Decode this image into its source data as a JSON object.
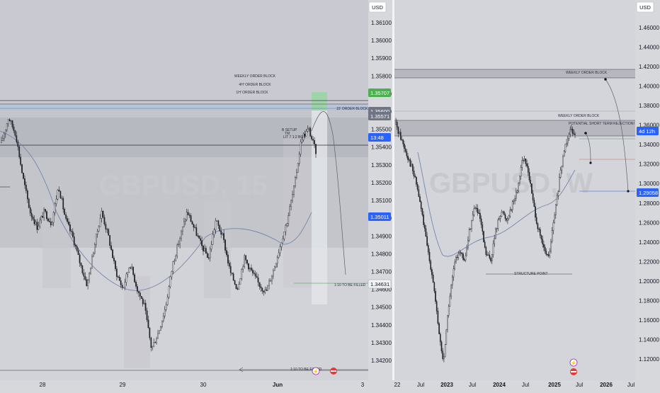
{
  "left": {
    "currency_label": "USD",
    "watermark_symbol": "GBPUSD, 15",
    "y_ticks": [
      "1.36100",
      "1.36000",
      "1.35900",
      "1.35800",
      "1.35700",
      "1.35600",
      "1.35500",
      "1.35400",
      "1.35300",
      "1.35200",
      "1.35100",
      "1.35000",
      "1.34900",
      "1.34800",
      "1.34700",
      "1.34600",
      "1.34500",
      "1.34400",
      "1.34300",
      "1.34200"
    ],
    "x_ticks": [
      "28",
      "29",
      "30",
      "Jun",
      "3"
    ],
    "price_tags": [
      {
        "label": "1.35707",
        "color": "#4caf50"
      },
      {
        "label": "1.35600",
        "color": "#707585"
      },
      {
        "label": "1.35571",
        "color": "#707585"
      },
      {
        "label": "13:48",
        "color": "#2962ff"
      },
      {
        "label": "1.35011",
        "color": "#2962ff"
      },
      {
        "label": "1.34631",
        "color": "#f0f2f5",
        "text_color": "#131722"
      }
    ],
    "annotations": {
      "weekly_ob": "WEEKLY ORDER BLOCK",
      "ob_4h": "4H' ORDER BLOCK",
      "ob_1h": "1H' ORDER BLOCK",
      "ob_15": "15' ORDER BLOCK",
      "setup_1": "B SETUP",
      "setup_2": "TM",
      "setup_3": "LIT 7 1:2 BOS",
      "target": "1:10 TO BE FILLED",
      "bottom_note": "1:10 TO BE FILLED"
    }
  },
  "right": {
    "currency_label": "USD",
    "watermark_symbol": "GBPUSD, W",
    "y_ticks": [
      "1.46000",
      "1.44000",
      "1.42000",
      "1.40000",
      "1.38000",
      "1.36000",
      "1.34000",
      "1.32000",
      "1.30000",
      "1.28000",
      "1.26000",
      "1.24000",
      "1.22000",
      "1.20000",
      "1.18000",
      "1.16000",
      "1.14000",
      "1.12000"
    ],
    "x_ticks": [
      "22",
      "Jul",
      "2023",
      "Jul",
      "2024",
      "Jul",
      "2025",
      "Jul",
      "2026",
      "Jul"
    ],
    "price_tags": [
      {
        "label": "4d 12h",
        "color": "#2962ff"
      },
      {
        "label": "1.29058",
        "color": "#2962ff"
      }
    ],
    "annotations": {
      "weekly_ob_top": "WEEKLY ORDER BLOCK",
      "weekly_ob": "WEEKLY ORDER BLOCK",
      "rejection": "POTENTIAL SHORT TERM REJECTION!",
      "structure": "STRUCTURE POINT"
    }
  },
  "chart_data": [
    {
      "type": "candlestick",
      "symbol": "GBPUSD",
      "timeframe": "15",
      "x_ticks": [
        "28",
        "29",
        "30",
        "Jun",
        "3"
      ],
      "ylim": [
        1.3415,
        1.362
      ],
      "close_path": [
        {
          "x": "27 early",
          "y": 1.3545
        },
        {
          "x": "27",
          "y": 1.356
        },
        {
          "x": "27",
          "y": 1.355
        },
        {
          "x": "27",
          "y": 1.3525
        },
        {
          "x": "27",
          "y": 1.3505
        },
        {
          "x": "27",
          "y": 1.3496
        },
        {
          "x": "27",
          "y": 1.3505
        },
        {
          "x": "27",
          "y": 1.3498
        },
        {
          "x": "27 late",
          "y": 1.352
        },
        {
          "x": "28",
          "y": 1.35
        },
        {
          "x": "28",
          "y": 1.349
        },
        {
          "x": "28",
          "y": 1.3475
        },
        {
          "x": "28",
          "y": 1.3462
        },
        {
          "x": "28",
          "y": 1.3485
        },
        {
          "x": "28",
          "y": 1.3505
        },
        {
          "x": "28",
          "y": 1.349
        },
        {
          "x": "28",
          "y": 1.347
        },
        {
          "x": "28",
          "y": 1.346
        },
        {
          "x": "28 late",
          "y": 1.3475
        },
        {
          "x": "29",
          "y": 1.346
        },
        {
          "x": "29",
          "y": 1.345
        },
        {
          "x": "29",
          "y": 1.3425
        },
        {
          "x": "29",
          "y": 1.3435
        },
        {
          "x": "29",
          "y": 1.345
        },
        {
          "x": "29",
          "y": 1.3475
        },
        {
          "x": "29",
          "y": 1.349
        },
        {
          "x": "29",
          "y": 1.3505
        },
        {
          "x": "29 late",
          "y": 1.3495
        },
        {
          "x": "30",
          "y": 1.3485
        },
        {
          "x": "30",
          "y": 1.3478
        },
        {
          "x": "30",
          "y": 1.35
        },
        {
          "x": "30",
          "y": 1.349
        },
        {
          "x": "30",
          "y": 1.347
        },
        {
          "x": "30",
          "y": 1.346
        },
        {
          "x": "30",
          "y": 1.3478
        },
        {
          "x": "30",
          "y": 1.347
        },
        {
          "x": "30 late",
          "y": 1.3463
        },
        {
          "x": "Jun",
          "y": 1.3458
        },
        {
          "x": "Jun",
          "y": 1.347
        },
        {
          "x": "Jun",
          "y": 1.3485
        },
        {
          "x": "Jun",
          "y": 1.35
        },
        {
          "x": "Jun",
          "y": 1.352
        },
        {
          "x": "Jun",
          "y": 1.3548
        },
        {
          "x": "Jun",
          "y": 1.3553
        },
        {
          "x": "Jun",
          "y": 1.354
        }
      ],
      "levels": {
        "weekly_ob_line": 1.3564,
        "ob_1h_line": 1.356,
        "mid_line": 1.354,
        "ob_15_top": 1.3571,
        "target": 1.3463
      }
    },
    {
      "type": "candlestick",
      "symbol": "GBPUSD",
      "timeframe": "W",
      "x_ticks": [
        "22",
        "Jul",
        "2023",
        "Jul",
        "2024",
        "Jul",
        "2025",
        "Jul",
        "2026",
        "Jul"
      ],
      "ylim": [
        1.105,
        1.475
      ],
      "close_path": [
        {
          "x": "22",
          "y": 1.36
        },
        {
          "x": "22",
          "y": 1.345
        },
        {
          "x": "22",
          "y": 1.33
        },
        {
          "x": "22",
          "y": 1.315
        },
        {
          "x": "Jul",
          "y": 1.295
        },
        {
          "x": "Jul",
          "y": 1.265
        },
        {
          "x": "Jul",
          "y": 1.23
        },
        {
          "x": "Jul",
          "y": 1.2
        },
        {
          "x": "Jul",
          "y": 1.15
        },
        {
          "x": "Jul",
          "y": 1.11
        },
        {
          "x": "2023",
          "y": 1.17
        },
        {
          "x": "2023",
          "y": 1.21
        },
        {
          "x": "2023",
          "y": 1.23
        },
        {
          "x": "2023",
          "y": 1.215
        },
        {
          "x": "2023",
          "y": 1.25
        },
        {
          "x": "Jul",
          "y": 1.275
        },
        {
          "x": "Jul",
          "y": 1.26
        },
        {
          "x": "Jul",
          "y": 1.225
        },
        {
          "x": "Jul",
          "y": 1.218
        },
        {
          "x": "2024",
          "y": 1.25
        },
        {
          "x": "2024",
          "y": 1.27
        },
        {
          "x": "2024",
          "y": 1.26
        },
        {
          "x": "2024",
          "y": 1.275
        },
        {
          "x": "Jul",
          "y": 1.29
        },
        {
          "x": "Jul",
          "y": 1.325
        },
        {
          "x": "Jul",
          "y": 1.315
        },
        {
          "x": "Jul",
          "y": 1.28
        },
        {
          "x": "2025",
          "y": 1.25
        },
        {
          "x": "2025",
          "y": 1.23
        },
        {
          "x": "2025",
          "y": 1.22
        },
        {
          "x": "2025",
          "y": 1.26
        },
        {
          "x": "2025",
          "y": 1.3
        },
        {
          "x": "2025",
          "y": 1.335
        },
        {
          "x": "Jul",
          "y": 1.355
        },
        {
          "x": "Jul",
          "y": 1.352
        }
      ],
      "levels": {
        "weekly_ob_top": 1.415,
        "weekly_ob_top_lower": 1.411,
        "weekly_ob": 1.358,
        "weekly_ob_lower": 1.3525,
        "current": 1.2906,
        "structure_point": 1.207
      }
    }
  ]
}
